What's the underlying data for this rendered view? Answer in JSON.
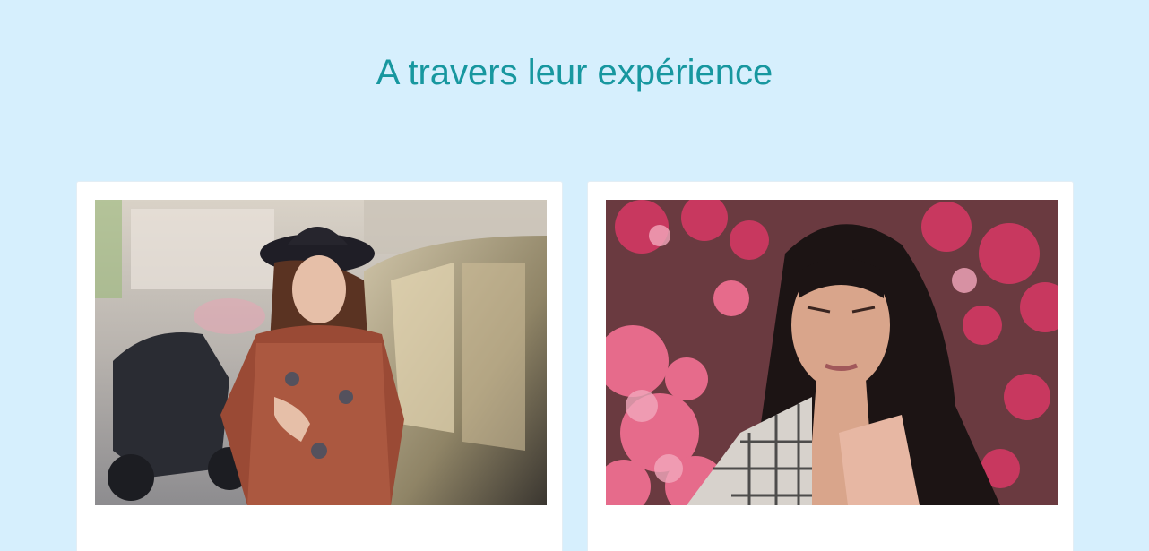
{
  "section": {
    "title": "A travers leur expérience"
  },
  "testimonials": [
    {
      "photo_description": "photo-woman-hat-street"
    },
    {
      "photo_description": "photo-woman-pink-flowers"
    }
  ],
  "colors": {
    "background": "#d6effd",
    "title": "#17979f",
    "card": "#ffffff"
  }
}
